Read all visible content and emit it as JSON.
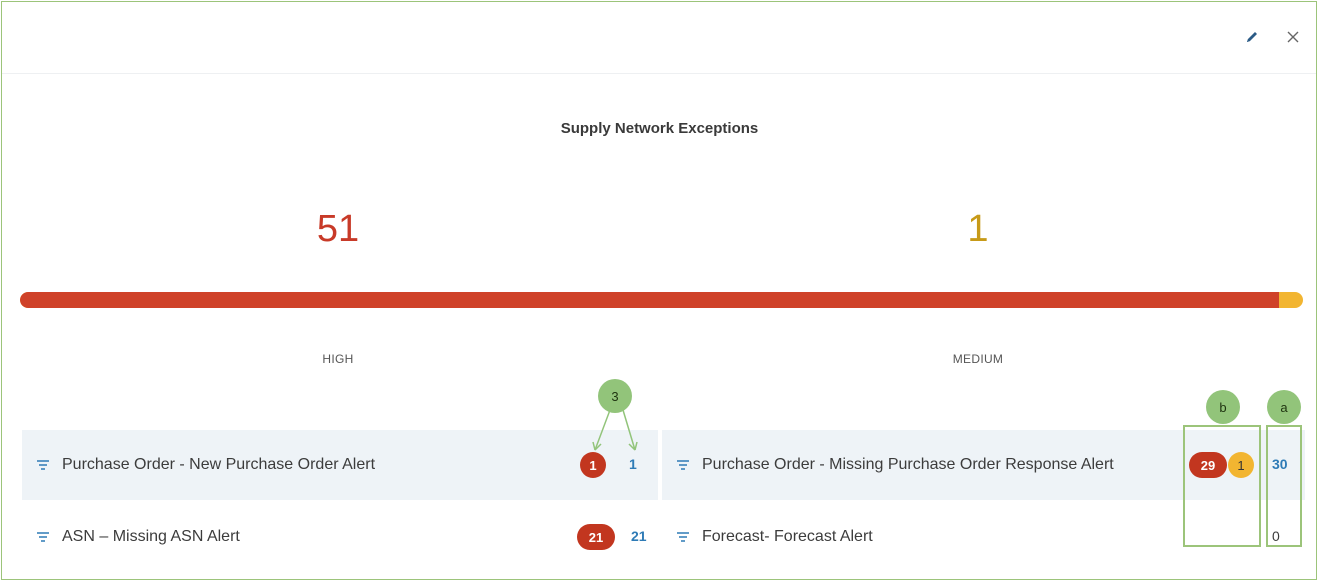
{
  "header": {
    "edit_icon": "pencil-icon",
    "close_icon": "close-icon"
  },
  "widget": {
    "title": "Supply Network Exceptions"
  },
  "summary": {
    "high": {
      "count": "51",
      "label": "HIGH",
      "color": "#cf4229"
    },
    "medium": {
      "count": "1",
      "label": "MEDIUM",
      "color": "#f2b531"
    },
    "bar_high_fraction": 0.981
  },
  "callouts": {
    "three": "3",
    "b": "b",
    "a": "a"
  },
  "alerts": [
    {
      "name": "Purchase Order - New Purchase Order Alert",
      "high": "1",
      "total": "1"
    },
    {
      "name": "Purchase Order - Missing Purchase Order Response Alert",
      "high": "29",
      "medium": "1",
      "total": "30"
    },
    {
      "name": "ASN – Missing ASN Alert",
      "high": "21",
      "total": "21"
    },
    {
      "name": "Forecast- Forecast Alert",
      "total": "0"
    }
  ],
  "colors": {
    "high": "#c2361f",
    "medium": "#f2b531",
    "link": "#2e7bb6",
    "annotation": "#92c47a"
  }
}
